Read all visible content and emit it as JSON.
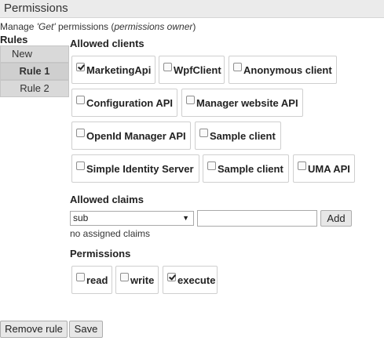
{
  "header": {
    "title": "Permissions"
  },
  "subtitle": {
    "prefix": "Manage ",
    "method": "'Get'",
    "middle": " permissions (",
    "owner": "permissions owner",
    "suffix": ")"
  },
  "rules": {
    "heading": "Rules",
    "items": [
      {
        "label": "New",
        "active": false
      },
      {
        "label": "Rule 1",
        "active": true
      },
      {
        "label": "Rule 2",
        "active": false
      }
    ]
  },
  "allowed_clients": {
    "heading": "Allowed clients",
    "clients": [
      {
        "label": "MarketingApi",
        "checked": true
      },
      {
        "label": "WpfClient",
        "checked": false
      },
      {
        "label": "Anonymous client",
        "checked": false
      },
      {
        "label": "Configuration API",
        "checked": false
      },
      {
        "label": "Manager website API",
        "checked": false
      },
      {
        "label": "OpenId Manager API",
        "checked": false
      },
      {
        "label": "Sample client",
        "checked": false
      },
      {
        "label": "Simple Identity Server",
        "checked": false
      },
      {
        "label": "Sample client",
        "checked": false
      },
      {
        "label": "UMA API",
        "checked": false
      }
    ]
  },
  "allowed_claims": {
    "heading": "Allowed claims",
    "selected": "sub",
    "input_value": "",
    "add_label": "Add",
    "empty_text": "no assigned claims"
  },
  "permissions": {
    "heading": "Permissions",
    "items": [
      {
        "label": "read",
        "checked": false
      },
      {
        "label": "write",
        "checked": false
      },
      {
        "label": "execute",
        "checked": true
      }
    ]
  },
  "footer": {
    "remove_label": "Remove rule",
    "save_label": "Save"
  }
}
